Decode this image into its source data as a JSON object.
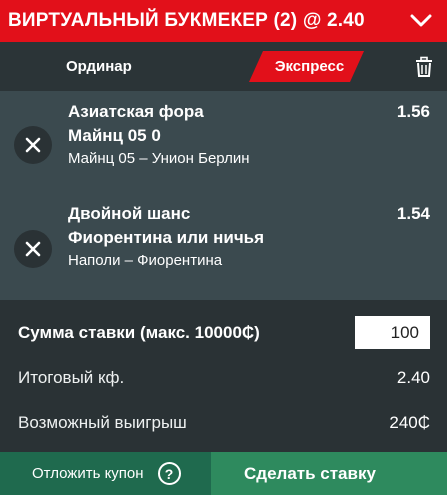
{
  "header": {
    "title": "ВИРТУАЛЬНЫЙ БУКМЕКЕР (2) @ 2.40",
    "collapse_icon": "chevron-down-icon"
  },
  "tabs": {
    "single": "Ординар",
    "express": "Экспресс",
    "express_color": "#e2101a",
    "trash_icon": "trash-icon"
  },
  "bets": [
    {
      "market": "Азиатская фора",
      "selection": "Майнц 05 0",
      "event": "Майнц 05 – Унион Берлин",
      "odd": "1.56"
    },
    {
      "market": "Двойной шанс",
      "selection": "Фиорентина или ничья",
      "event": "Наполи – Фиорентина",
      "odd": "1.54"
    }
  ],
  "summary": {
    "stake_label": "Сумма ставки (макс. 10000₵)",
    "stake_value": "100",
    "total_label": "Итоговый кф.",
    "total_value": "2.40",
    "win_label": "Возможный выигрыш",
    "win_value": "240₵"
  },
  "footer": {
    "postpone": "Отложить купон",
    "help": "?",
    "place": "Сделать ставку"
  },
  "colors": {
    "brand_red": "#e2101a",
    "green_dark": "#1f6a4e",
    "green": "#2e8a5e"
  }
}
